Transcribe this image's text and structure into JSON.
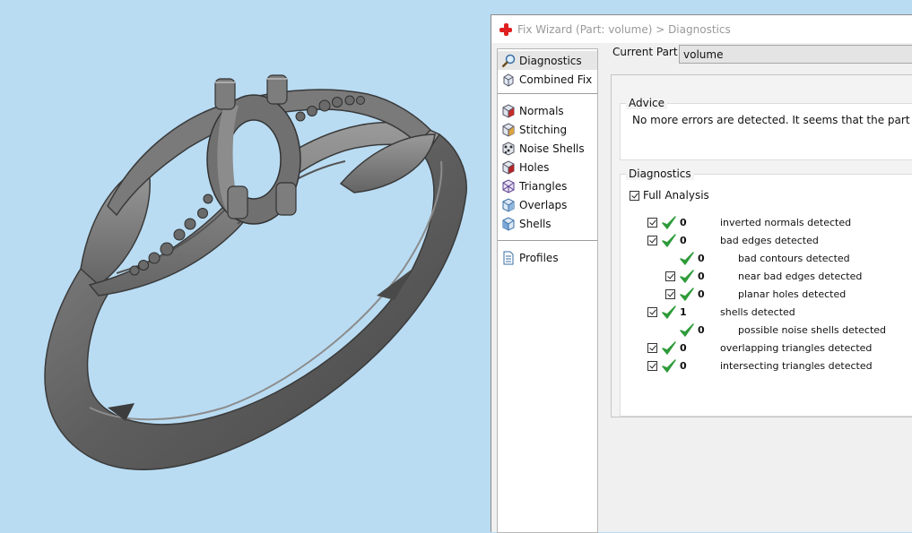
{
  "window": {
    "title": "Fix Wizard (Part: volume) > Diagnostics"
  },
  "sidebar": {
    "top_items": [
      {
        "label": "Diagnostics",
        "icon": "magnifier-icon",
        "selected": true
      },
      {
        "label": "Combined Fix",
        "icon": "cube-icon",
        "selected": false
      }
    ],
    "tool_items": [
      {
        "label": "Normals",
        "icon": "normals-cube-icon"
      },
      {
        "label": "Stitching",
        "icon": "stitching-cube-icon"
      },
      {
        "label": "Noise Shells",
        "icon": "noise-shells-icon"
      },
      {
        "label": "Holes",
        "icon": "holes-cube-icon"
      },
      {
        "label": "Triangles",
        "icon": "triangles-cube-icon"
      },
      {
        "label": "Overlaps",
        "icon": "overlaps-cube-icon"
      },
      {
        "label": "Shells",
        "icon": "shells-cube-icon"
      }
    ],
    "bottom_items": [
      {
        "label": "Profiles",
        "icon": "document-icon"
      }
    ]
  },
  "current_part": {
    "label": "Current Part:",
    "value": "volume"
  },
  "advice": {
    "legend": "Advice",
    "text": "No more errors are detected. It seems that the part is ok."
  },
  "diagnostics": {
    "legend": "Diagnostics",
    "full_analysis_label": "Full Analysis",
    "full_analysis_checked": true,
    "rows": [
      {
        "count": "0",
        "label": "inverted normals detected",
        "indent": 0,
        "checkbox": true
      },
      {
        "count": "0",
        "label": "bad edges detected",
        "indent": 0,
        "checkbox": true
      },
      {
        "count": "0",
        "label": "bad contours detected",
        "indent": 1,
        "checkbox": false
      },
      {
        "count": "0",
        "label": "near bad edges detected",
        "indent": 1,
        "checkbox": true
      },
      {
        "count": "0",
        "label": "planar holes detected",
        "indent": 1,
        "checkbox": true
      },
      {
        "count": "1",
        "label": "shells detected",
        "indent": 0,
        "checkbox": true
      },
      {
        "count": "0",
        "label": "possible noise shells detected",
        "indent": 1,
        "checkbox": false
      },
      {
        "count": "0",
        "label": "overlapping triangles detected",
        "indent": 0,
        "checkbox": true
      },
      {
        "count": "0",
        "label": "intersecting triangles detected",
        "indent": 0,
        "checkbox": true
      }
    ]
  },
  "colors": {
    "viewport_bg": "#b9dcf3",
    "model_gray": "#6f6f6f",
    "ok_check": "#2e9b3a",
    "title_cross": "#e02020"
  }
}
